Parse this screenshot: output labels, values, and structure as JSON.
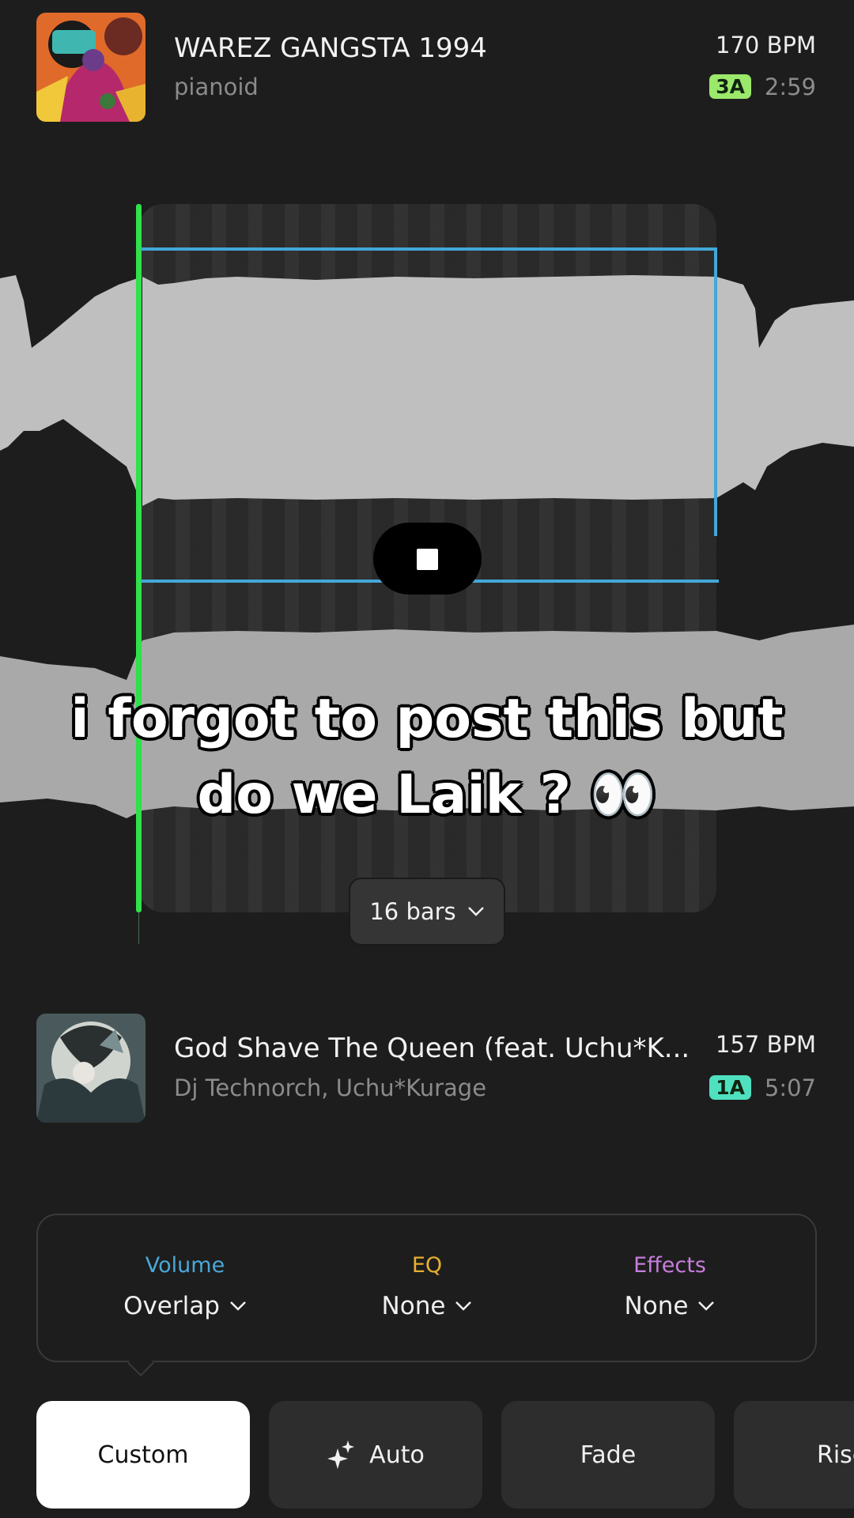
{
  "track_a": {
    "title": "WAREZ GANGSTA 1994",
    "artist": "pianoid",
    "bpm": "170 BPM",
    "key": "3A",
    "key_color": "#9be86a",
    "duration": "2:59"
  },
  "track_b": {
    "title": "God Shave The Queen (feat. Uchu*K...",
    "artist": "Dj Technorch, Uchu*Kurage",
    "bpm": "157 BPM",
    "key": "1A",
    "key_color": "#4fe0c0",
    "duration": "5:07"
  },
  "caption": {
    "line1": "i forgot to post this but",
    "line2": "do we Laik ? 👀"
  },
  "loop_length": "16 bars",
  "transition": {
    "volume": {
      "label": "Volume",
      "value": "Overlap",
      "color": "#4aa8d8"
    },
    "eq": {
      "label": "EQ",
      "value": "None",
      "color": "#e6b030"
    },
    "effects": {
      "label": "Effects",
      "value": "None",
      "color": "#c77ddc"
    }
  },
  "presets": [
    "Custom",
    "Auto",
    "Fade",
    "Rise"
  ],
  "active_preset": "Custom",
  "colors": {
    "background": "#1d1d1d",
    "playhead": "#2fe14a",
    "loop": "#43a7d8"
  }
}
